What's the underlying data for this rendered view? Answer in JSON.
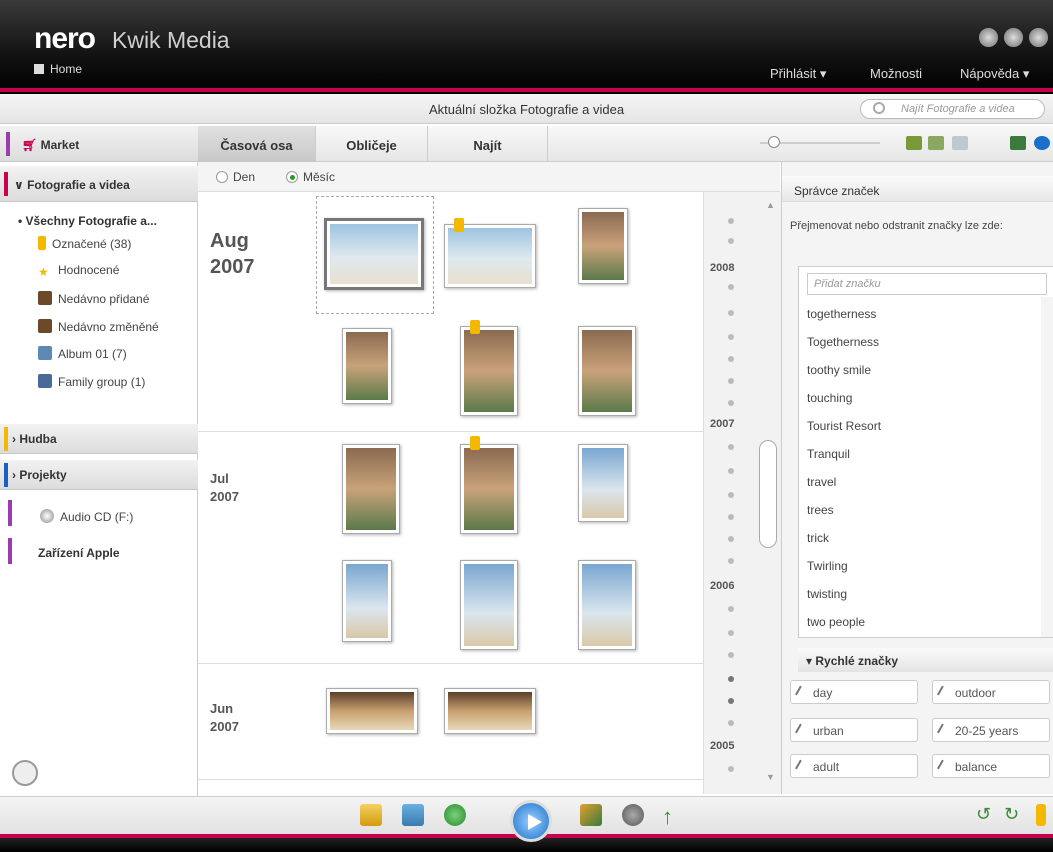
{
  "app": {
    "brand": "nero",
    "name": "Kwik Media",
    "home": "Home"
  },
  "topmenu": {
    "login": "Přihlásit",
    "options": "Možnosti",
    "help": "Nápověda"
  },
  "address": {
    "folder": "Aktuální složka Fotografie a videa",
    "search_placeholder": "Najít Fotografie a videa"
  },
  "sidebar": {
    "market": "Market",
    "photos": "Fotografie a videa",
    "all": "Všechny Fotografie a...",
    "items": [
      "Označené (38)",
      "Hodnocené",
      "Nedávno přidané",
      "Nedávno změněné",
      "Album 01 (7)",
      "Family group (1)"
    ],
    "music": "Hudba",
    "projects": "Projekty",
    "audiocd": "Audio CD (F:)",
    "apple": "Zařízení Apple"
  },
  "tabs": [
    "Časová osa",
    "Obličeje",
    "Najít"
  ],
  "view": {
    "day": "Den",
    "month": "Měsíc"
  },
  "months": [
    {
      "m": "Aug",
      "y": "2007"
    },
    {
      "m": "Jul",
      "y": "2007"
    },
    {
      "m": "Jun",
      "y": "2007"
    }
  ],
  "timeline": {
    "years": [
      "2008",
      "2007",
      "2006",
      "2005"
    ]
  },
  "tagmgr": {
    "title": "Správce značek",
    "desc": "Přejmenovat nebo odstranit značky lze zde:",
    "input_placeholder": "Přidat značku",
    "tags": [
      "togetherness",
      "Togetherness",
      "toothy smile",
      "touching",
      "Tourist Resort",
      "Tranquil",
      "travel",
      "trees",
      "trick",
      "Twirling",
      "twisting",
      "two people"
    ]
  },
  "quick": {
    "title": "Rychlé značky",
    "tags": [
      "day",
      "outdoor",
      "urban",
      "20-25 years",
      "adult",
      "balance"
    ]
  },
  "colors": {
    "accent": "#c8004e",
    "titlebar": "#111111",
    "badge": "#f5b800"
  }
}
